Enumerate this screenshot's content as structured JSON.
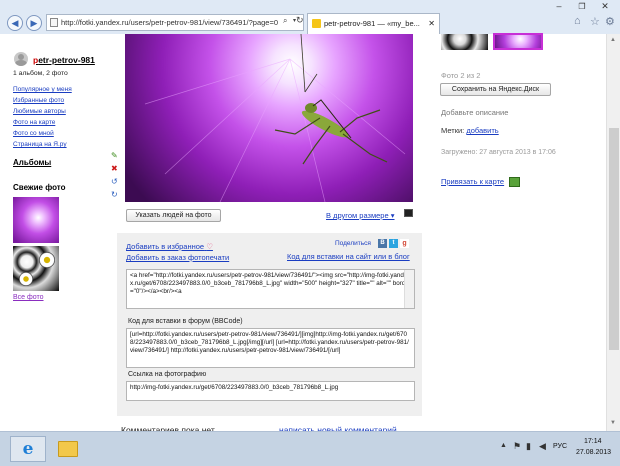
{
  "browser": {
    "address_url": "http://fotki.yandex.ru/users/petr-petrov-981/view/736491/?page=0",
    "tab_title": "petr-petrov-981 — «my_be..."
  },
  "sidebar": {
    "username": "petr-petrov-981",
    "stats": "1 альбом, 2 фото",
    "links": [
      "Популярное у меня",
      "Избранные фото",
      "Любимые авторы",
      "Фото на карте",
      "Фото со мной",
      "Страница на Я.ру"
    ],
    "albums_heading": "Альбомы",
    "fresh_heading": "Свежие фото",
    "all_photos": "Все фото"
  },
  "photo_actions": {
    "tag_people": "Указать людей на фото",
    "other_size": "В другом размере ▾"
  },
  "share": {
    "add_favorite": "Добавить в избранное",
    "add_print": "Добавить в заказ фотопечати",
    "share_label": "Поделиться",
    "embed_link": "Код для вставки на сайт или в блог",
    "html_code": "<a href=\"http://fotki.yandex.ru/users/petr-petrov-981/view/736491/\"><img src=\"http://img-fotki.yandex.ru/get/6708/223497883.0/0_b3ceb_781796b8_L.jpg\" width=\"500\" height=\"327\" title=\"\" alt=\"\" border=\"0\"/></a><br/><a",
    "forum_label": "Код для вставки в форум (BBCode)",
    "forum_code": "[url=http://fotki.yandex.ru/users/petr-petrov-981/view/736491/][img]http://img-fotki.yandex.ru/get/6708/223497883.0/0_b3ceb_781796b8_L.jpg[/img][/url] [url=http://fotki.yandex.ru/users/petr-petrov-981/view/736491/] http://fotki.yandex.ru/users/petr-petrov-981/view/736491/[/url]",
    "link_label": "Ссылка на фотографию",
    "link_code": "http://img-fotki.yandex.ru/get/6708/223497883.0/0_b3ceb_781796b8_L.jpg"
  },
  "comments": {
    "no_comments": "Комментариев пока нет",
    "write_comment": "написать новый комментарий"
  },
  "right_panel": {
    "photo_count": "Фото 2 из 2",
    "save_disk": "Сохранить на Яндекс.Диск",
    "add_description": "Добавьте описание",
    "tags_label": "Метки:",
    "tags_add": "добавить",
    "uploaded": "Загружено: 27 августа 2013 в 17:06",
    "map_link": "Привязать к карте"
  },
  "taskbar": {
    "lang": "РУС",
    "time": "17:14",
    "date": "27.08.2013"
  },
  "colors": {
    "link": "#1a3dc1",
    "username_first_letter": "#cc0000",
    "panel_bg": "#efefef",
    "taskbar_bg": "#c5d3e3"
  }
}
